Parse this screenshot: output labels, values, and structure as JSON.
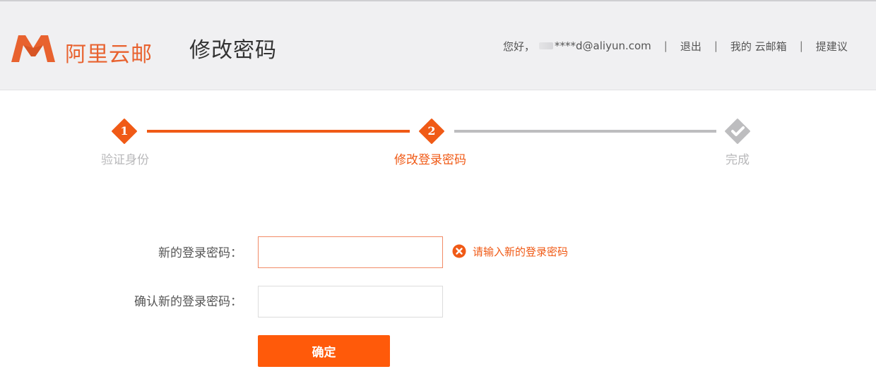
{
  "header": {
    "logo_text": "阿里云邮",
    "page_title": "修改密码",
    "greeting": "您好，",
    "user_email": "****d@aliyun.com",
    "logout": "退出",
    "my_mailbox": "我的 云邮箱",
    "feedback": "提建议",
    "separator": "|"
  },
  "steps": [
    {
      "number": "1",
      "label": "验证身份",
      "state": "done"
    },
    {
      "number": "2",
      "label": "修改登录密码",
      "state": "active"
    },
    {
      "number": "",
      "label": "完成",
      "state": "todo",
      "icon": "check-icon"
    }
  ],
  "form": {
    "new_password_label": "新的登录密码：",
    "new_password_value": "",
    "confirm_password_label": "确认新的登录密码：",
    "confirm_password_value": "",
    "error_message": "请输入新的登录密码",
    "submit_label": "确定"
  },
  "colors": {
    "accent": "#f05a16",
    "button": "#ff5a0a",
    "inactive": "#bdbdbf",
    "header_bg": "#f0f0f2"
  }
}
